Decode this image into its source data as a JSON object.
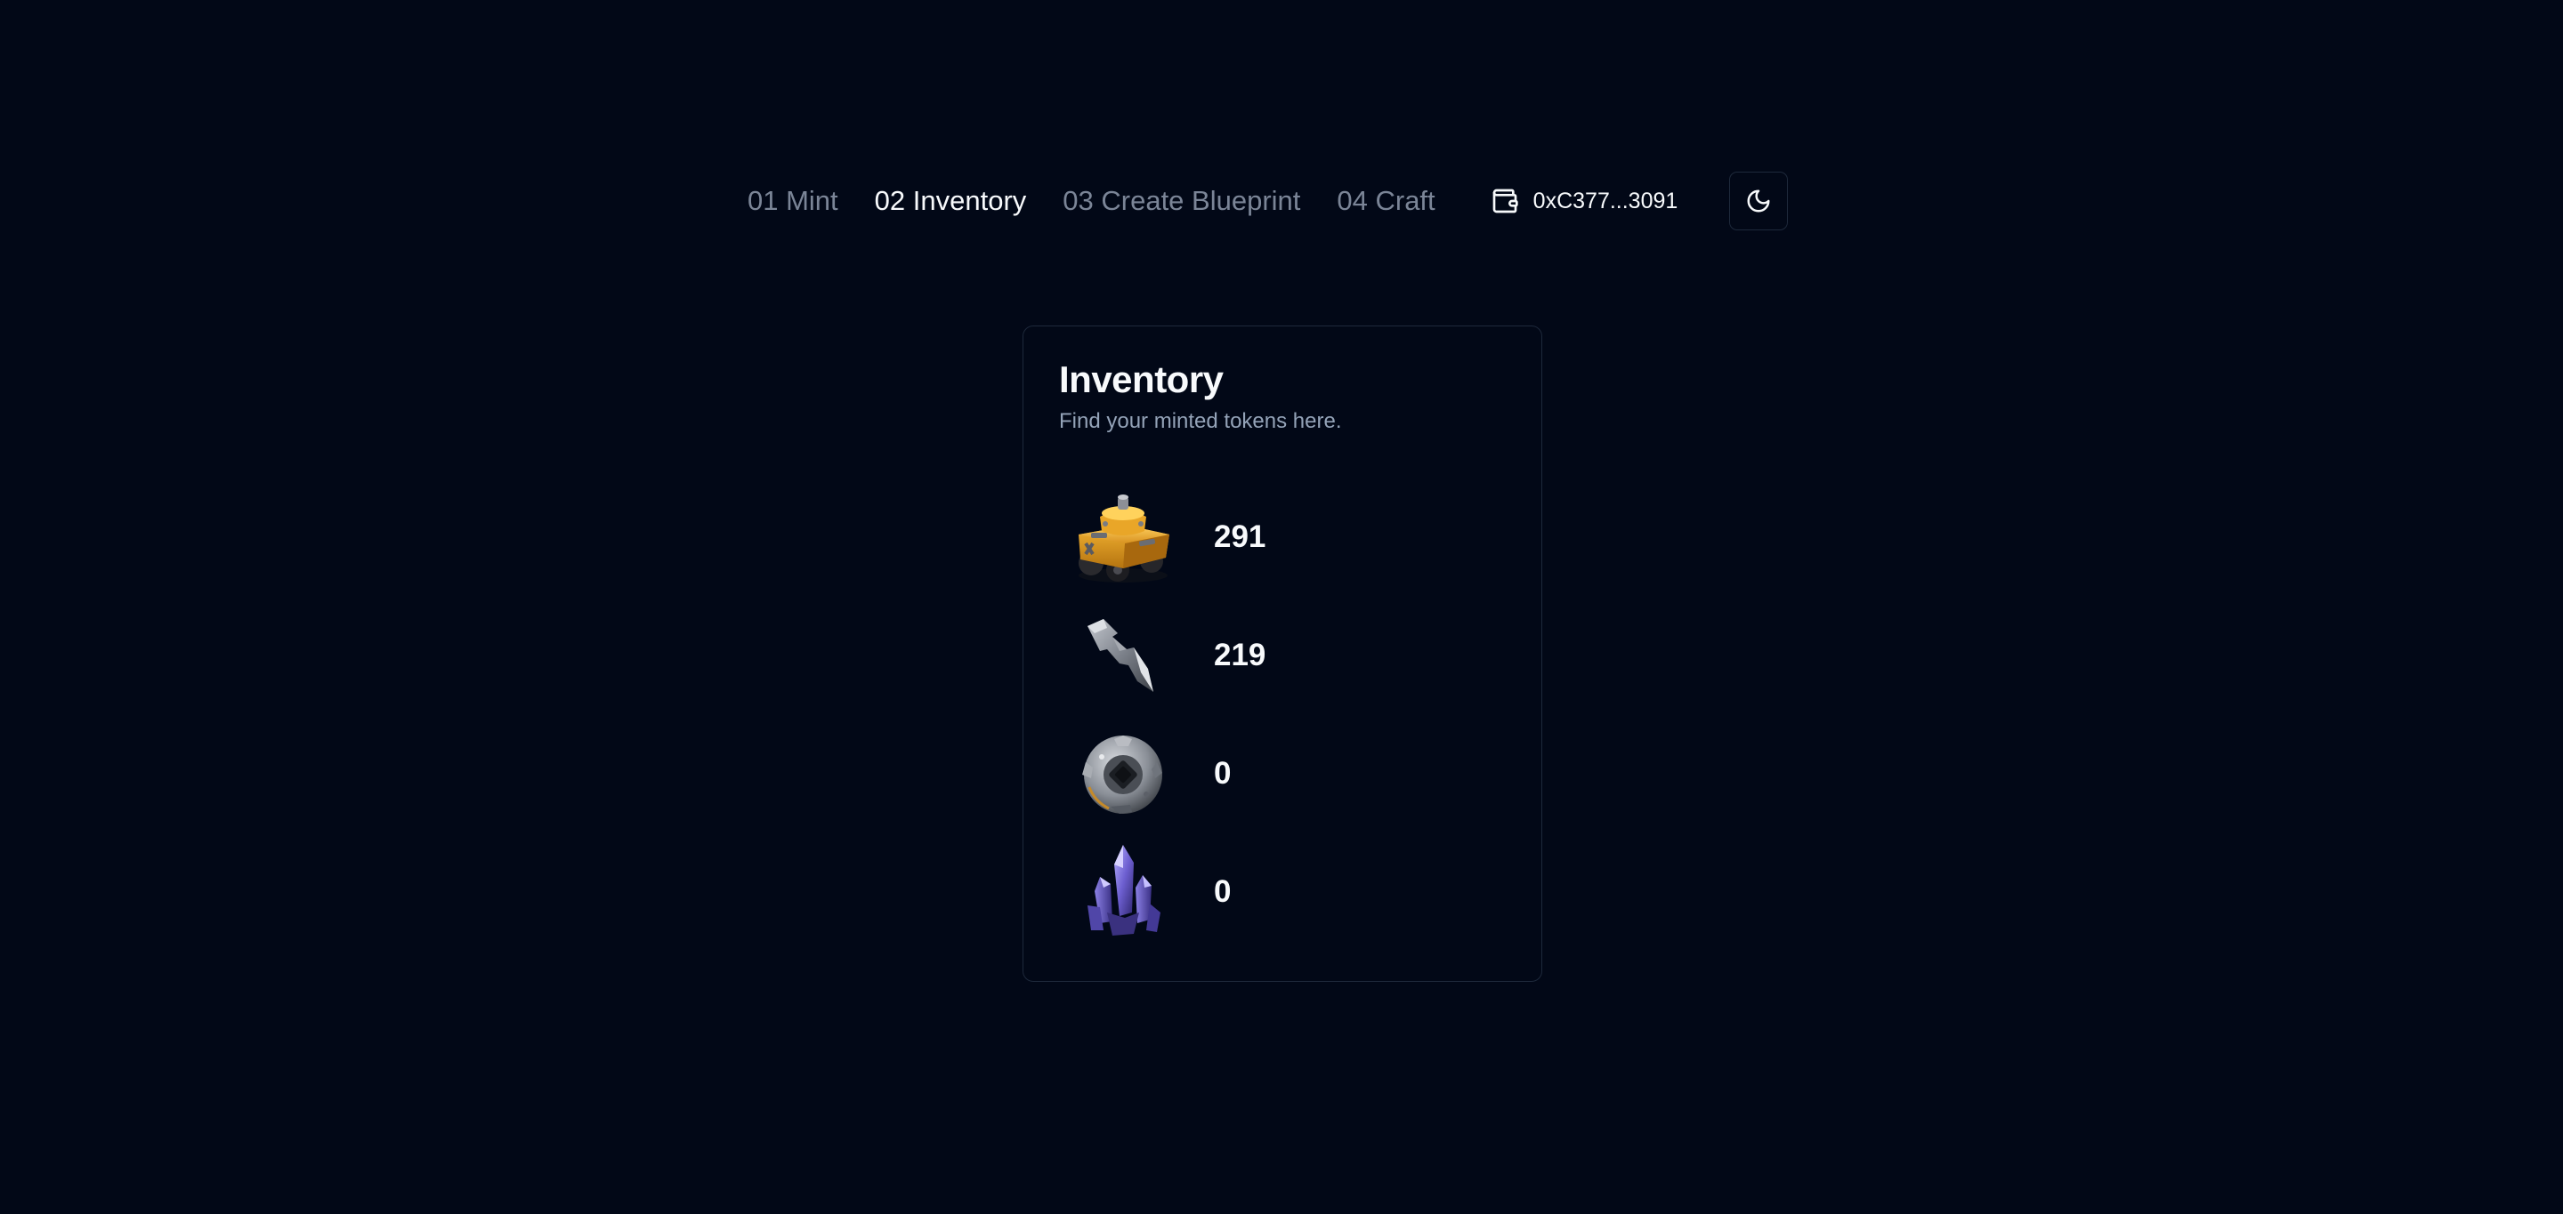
{
  "nav": {
    "items": [
      {
        "label": "01 Mint",
        "active": false
      },
      {
        "label": "02 Inventory",
        "active": true
      },
      {
        "label": "03 Create Blueprint",
        "active": false
      },
      {
        "label": "04 Craft",
        "active": false
      }
    ]
  },
  "wallet": {
    "icon": "wallet-icon",
    "address": "0xC377...3091"
  },
  "theme_toggle": {
    "icon": "moon-icon"
  },
  "inventory": {
    "title": "Inventory",
    "subtitle": "Find your minted tokens here.",
    "items": [
      {
        "icon": "tank-icon",
        "count": "291"
      },
      {
        "icon": "metal-shard-icon",
        "count": "219"
      },
      {
        "icon": "gear-wheel-icon",
        "count": "0"
      },
      {
        "icon": "crystal-icon",
        "count": "0"
      }
    ]
  },
  "colors": {
    "background": "#020817",
    "border": "#1e293b",
    "text_primary": "#f8fafc",
    "text_muted": "#94a3b8",
    "nav_inactive": "#7b8597"
  }
}
